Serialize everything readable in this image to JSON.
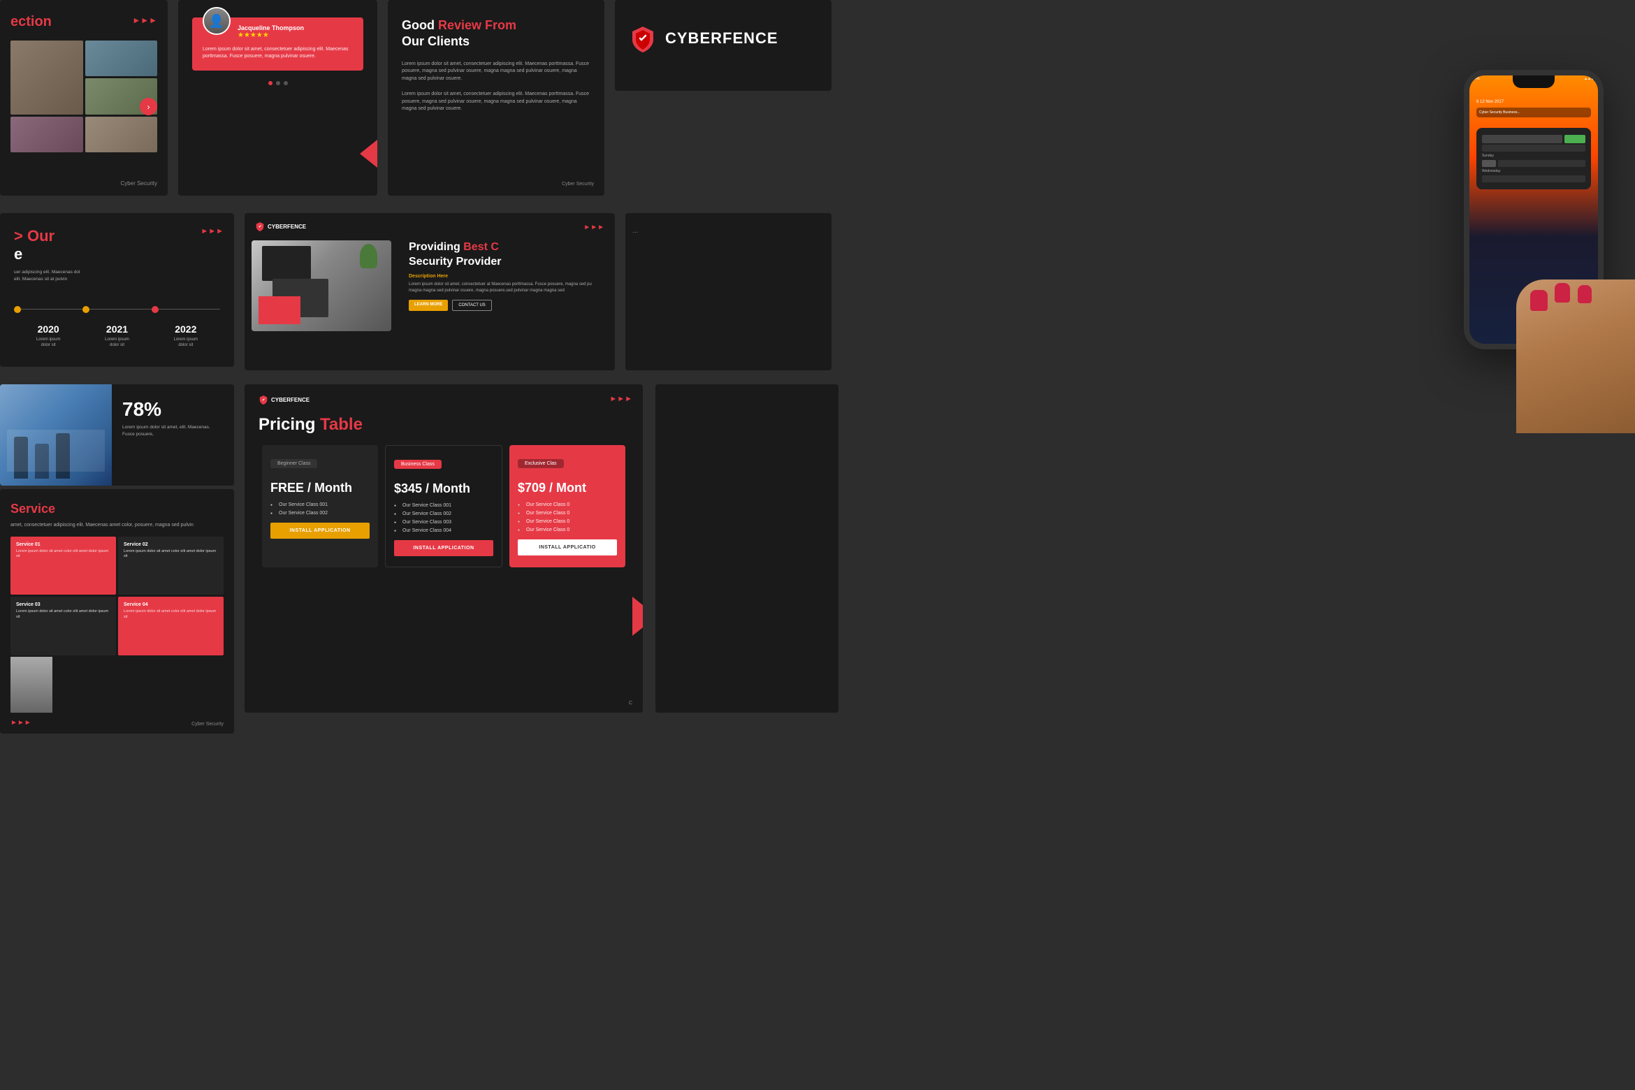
{
  "app": {
    "background_color": "#2d2d2d"
  },
  "brand": {
    "name": "CYBERFENCE",
    "tagline": "Cyber Security"
  },
  "slide1": {
    "title": "ection",
    "arrows": "►►►",
    "footer": "Cyber Security"
  },
  "slide2": {
    "reviewer": {
      "name": "Jacqueline Thompson",
      "rating": "★★★★★"
    },
    "review_text": "Lorem ipsum dolor sit amet, consectetuer adipiscing elit. Maecenas porttmassa. Fusce posuere, magna pulvinar osuere.",
    "dots": [
      "active",
      "inactive",
      "inactive"
    ]
  },
  "slide3": {
    "title_black": "Good",
    "title_red": "Review From",
    "title_black2": "Our Clients",
    "body1": "Lorem ipsum dolor sit amet, consectetuer adipiscing elit. Maecenas porttmassa. Fusce posuere, magna sed pulvinar osuere, magna magna sed pulvinar osuere, magna magna sed pulvinar osuere.",
    "body2": "Lorem ipsum dolor sit amet, consectetuer adipiscing elit. Maecenas porttmassa. Fusce posuere, magna sed pulvinar osuere, magna magna sed pulvinar osuere, magna magna sed pulvinar osuere.",
    "footer": "Cyber Security"
  },
  "slide4": {
    "logo_text": "CYBERFENCE"
  },
  "slide5": {
    "title_red": "> Our",
    "title_white": "e",
    "arrows": "►►►",
    "years": [
      {
        "year": "2020",
        "text": "Lorem ipsum\ndolor sit"
      },
      {
        "year": "2021",
        "text": "Lorem ipsum\ndolor sit"
      },
      {
        "year": "2022",
        "text": "Lorem ipsum\ndolor sit"
      }
    ],
    "body": "uer adipiscing elit. Maecenas dol\nelt. Maecenas sit at pulvin"
  },
  "slide6": {
    "brand": "CYBERFENCE",
    "arrows": "►►►",
    "title": "Providing Best C",
    "title2": "Security Provider",
    "title_red": "Best C",
    "description_label": "Description Here",
    "description": "Lorem ipsum dolor sit amet, consectetuer at Maecenas porttmassa. Fusce posuere, magna sed pu magna magna sed pulvinar osuere, magna posuere,sed pulvinar magna magna sed",
    "btn_learn": "LEARN MORE",
    "btn_contact": "CONTACT US"
  },
  "slide8": {
    "percent": "78%",
    "desc": "Lorem ipsum dolor sit amet, elit. Maecenas. Fusce posuere,"
  },
  "slide9": {
    "brand": "CYBERFENCE",
    "arrows": "►►►",
    "title_black": "Pricing ",
    "title_red": "Table",
    "cards": [
      {
        "badge": "Beginner Class",
        "badge_style": "dark",
        "price": "FREE / Month",
        "services": [
          "Our Service Class 001",
          "Our Service Class 002"
        ],
        "btn_label": "INSTALL APPLICATION",
        "btn_style": "gold"
      },
      {
        "badge": "Business Class",
        "badge_style": "red",
        "price": "$345 / Month",
        "services": [
          "Our Service Class 001",
          "Our Service Class 002",
          "Our Service Class 003",
          "Our Service Class 004"
        ],
        "btn_label": "INSTALL APPLICATION",
        "btn_style": "red"
      },
      {
        "badge": "Exclusive Class",
        "badge_style": "dark",
        "price": "$709 / Mont",
        "services": [
          "Our Service Class 0",
          "Our Service Class 0",
          "Our Service Class 0",
          "Our Service Class 0"
        ],
        "btn_label": "INSTALL APPLICATIO",
        "btn_style": "white"
      }
    ]
  },
  "slide11": {
    "title": "Service",
    "desc": "amet, consectetuer adipiscing elit. Maecenas amet color, posuere, magna sed pulvin",
    "services": [
      {
        "title": "Service 01",
        "desc": "Lorem ipsum dolor sit amet color elit amet dolor ipsum sit",
        "style": "red"
      },
      {
        "title": "Service 02",
        "desc": "Lorem ipsum dolor sit amet color elit amet dolor ipsum sit",
        "style": "dark"
      },
      {
        "title": "Service 03",
        "desc": "Lorem ipsum dolor sit amet color elit amet dolor ipsum sit",
        "style": "dark"
      },
      {
        "title": "Service 04",
        "desc": "Lorem ipsum dolor sit amet color elit amet dolor ipsum sit",
        "style": "red"
      }
    ],
    "footer": "Cyber Security",
    "arrows": "►►►"
  },
  "exclusive": {
    "badge": "Exclusive Clas",
    "price": "$709 / Mont",
    "services": [
      "Our Service Class 0",
      "Our Service Class 0",
      "Our Service Class 0",
      "Our Service Class 0"
    ],
    "btn": "INSTALL APPLICATIO"
  },
  "phone": {
    "time": "9:41",
    "date": "6 12 Nov 2017"
  }
}
